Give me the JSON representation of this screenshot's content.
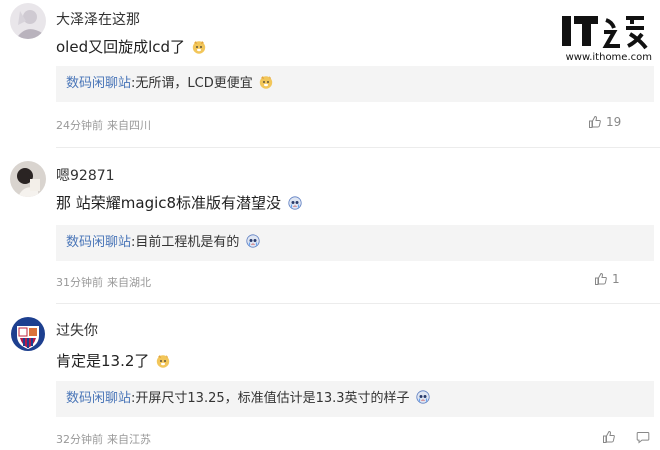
{
  "watermark": {
    "logo_text": "IT之家",
    "url": "www.ithome.com"
  },
  "comments": [
    {
      "username": "大泽泽在这那",
      "text": "oled又回旋成lcd了",
      "emoji": "doge-emoji",
      "reply_user": "数码闲聊站",
      "reply_text": ":无所谓，LCD更便宜",
      "reply_emoji": "doge-emoji",
      "time": "24分钟前",
      "location": "来自四川",
      "likes": "19"
    },
    {
      "username": "嗯92871",
      "text": "那 站荣耀magic8标准版有潜望没",
      "emoji": "cry-emoji",
      "reply_user": "数码闲聊站",
      "reply_text": ":目前工程机是有的",
      "reply_emoji": "cry-emoji",
      "time": "31分钟前",
      "location": "来自湖北",
      "likes": "1"
    },
    {
      "username": "过失你",
      "text": "肯定是13.2了",
      "emoji": "doge-emoji",
      "reply_user": "数码闲聊站",
      "reply_text": ":开屏尺寸13.25，标准值估计是13.3英寸的样子",
      "reply_emoji": "cry-emoji",
      "time": "32分钟前",
      "location": "来自江苏",
      "likes": ""
    }
  ],
  "colors": {
    "reply_user": "#4a76b8",
    "reply_bg": "#f4f4f4",
    "meta": "#999999"
  }
}
